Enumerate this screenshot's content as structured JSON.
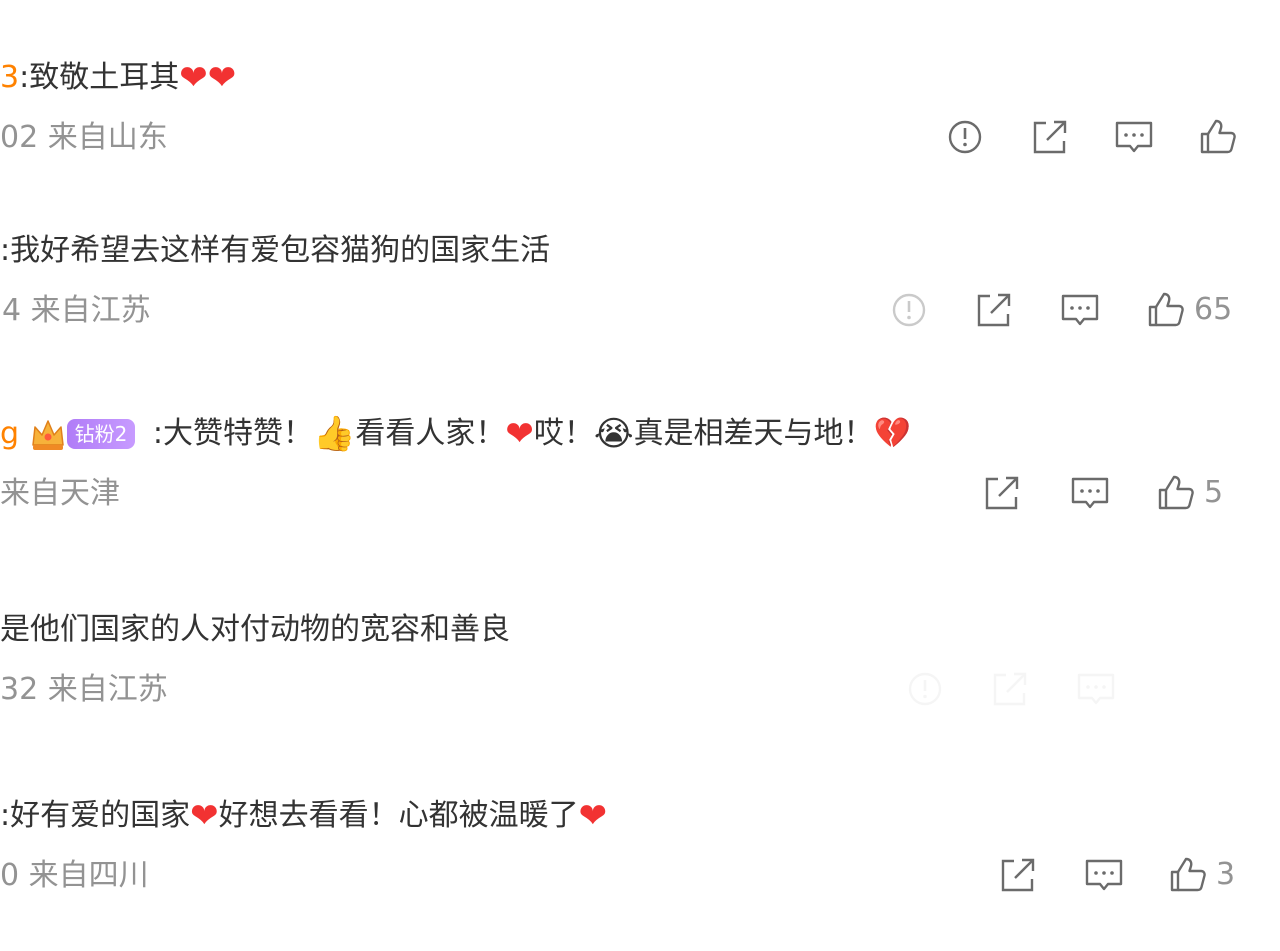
{
  "comments": [
    {
      "user_fragment": "3",
      "text": ":致敬土耳其",
      "meta": "02 来自山东",
      "like_count": ""
    },
    {
      "user_fragment": "",
      "text": ":我好希望去这样有爱包容猫狗的国家生活",
      "meta": "4 来自江苏",
      "like_count": "65"
    },
    {
      "user_fragment": "g",
      "fan_badge": "钻粉2",
      "text_parts": [
        " :大赞特赞！",
        "看看人家！",
        "哎！",
        "真是相差天与地！"
      ],
      "meta": "来自天津",
      "like_count": "5"
    },
    {
      "user_fragment": "",
      "text": "是他们国家的人对付动物的宽容和善良",
      "meta": "32 来自江苏",
      "like_count": ""
    },
    {
      "user_fragment": "",
      "text_parts": [
        ":好有爱的国家",
        "好想去看看！心都被温暖了"
      ],
      "meta": "0 来自四川",
      "like_count": "3"
    }
  ],
  "icons": {
    "report": "report-icon",
    "share": "share-icon",
    "comment": "comment-icon",
    "like": "like-icon"
  },
  "colors": {
    "username": "#ff8200",
    "text": "#333333",
    "meta": "#939393",
    "icon": "#6b6b6b"
  }
}
